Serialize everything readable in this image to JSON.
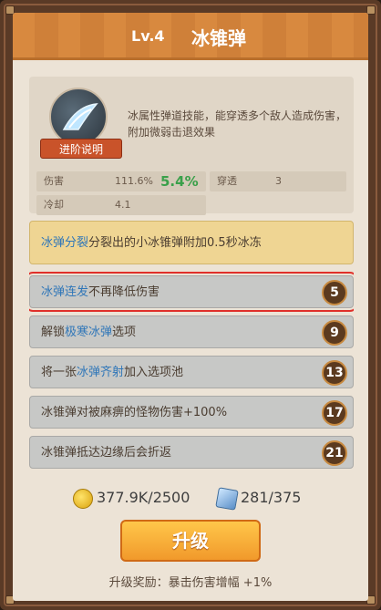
{
  "header": {
    "level": "Lv.4",
    "name": "冰锥弹"
  },
  "skill": {
    "icon": "ice-cone-icon",
    "description": "冰属性弹道技能，能穿透多个敌人造成伤害，附加微弱击退效果",
    "advance_label": "进阶说明",
    "stats": {
      "damage_label": "伤害",
      "damage_value": "111.6%",
      "damage_bonus": "5.4%",
      "pierce_label": "穿透",
      "pierce_value": "3",
      "cooldown_label": "冷却",
      "cooldown_value": "4.1"
    }
  },
  "upgrades": [
    {
      "pre": "",
      "hl": "冰弹分裂",
      "post": "分裂出的小冰锥弹附加0.5秒冰冻",
      "num": ""
    },
    {
      "pre": "",
      "hl": "冰弹连发",
      "post": "不再降低伤害",
      "num": "5"
    },
    {
      "pre": "解锁",
      "hl": "极寒冰弹",
      "post": "选项",
      "num": "9"
    },
    {
      "pre": "将一张",
      "hl": "冰弹齐射",
      "post": "加入选项池",
      "num": "13"
    },
    {
      "pre": "冰锥弹对被麻痹的怪物伤害+100%",
      "hl": "",
      "post": "",
      "num": "17"
    },
    {
      "pre": "冰锥弹抵达边缘后会折返",
      "hl": "",
      "post": "",
      "num": "21"
    }
  ],
  "resources": {
    "coins": "377.9K/2500",
    "shards": "281/375"
  },
  "upgrade_button": "升级",
  "reward": "升级奖励：暴击伤害增幅 +1%",
  "colors": {
    "accent": "#f1992b",
    "highlight_text": "#2f76b8",
    "bonus_green": "#3aa04a"
  }
}
